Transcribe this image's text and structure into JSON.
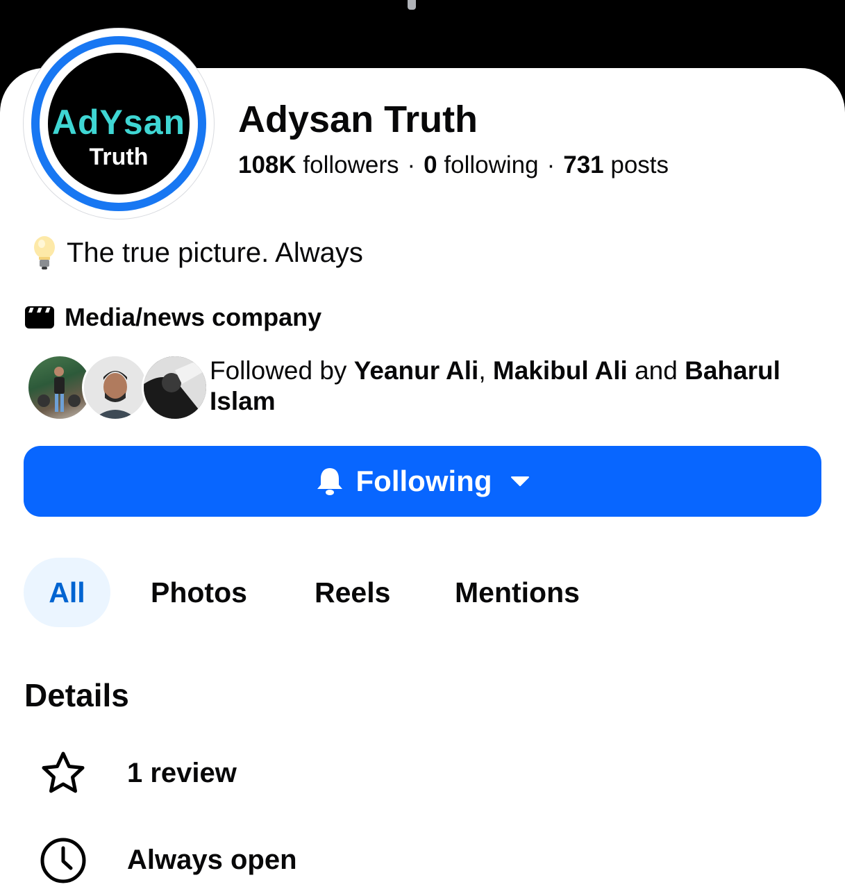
{
  "profile": {
    "name": "Adysan Truth",
    "logo_main": "AdYsan",
    "logo_sub": "Truth",
    "stats": {
      "followers_count": "108K",
      "followers_label": "followers",
      "following_count": "0",
      "following_label": "following",
      "posts_count": "731",
      "posts_label": "posts",
      "separator": "·"
    },
    "bio": "The true picture. Always",
    "category": "Media/news company"
  },
  "followed_by": {
    "prefix": "Followed by",
    "name1": "Yeanur Ali",
    "comma": ",",
    "name2": "Makibul Ali",
    "and": "and",
    "name3": "Baharul Islam"
  },
  "follow_button": {
    "label": "Following",
    "icon": "bell-icon"
  },
  "tabs": [
    {
      "label": "All",
      "active": true
    },
    {
      "label": "Photos",
      "active": false
    },
    {
      "label": "Reels",
      "active": false
    },
    {
      "label": "Mentions",
      "active": false
    }
  ],
  "details": {
    "title": "Details",
    "items": [
      {
        "icon": "star-icon",
        "text": "1 review"
      },
      {
        "icon": "clock-icon",
        "text": "Always open"
      }
    ]
  },
  "colors": {
    "accent": "#0866ff",
    "active_tab_bg": "#ebf5ff",
    "active_tab_text": "#0064d1",
    "logo_cyan": "#3fd6d3"
  }
}
